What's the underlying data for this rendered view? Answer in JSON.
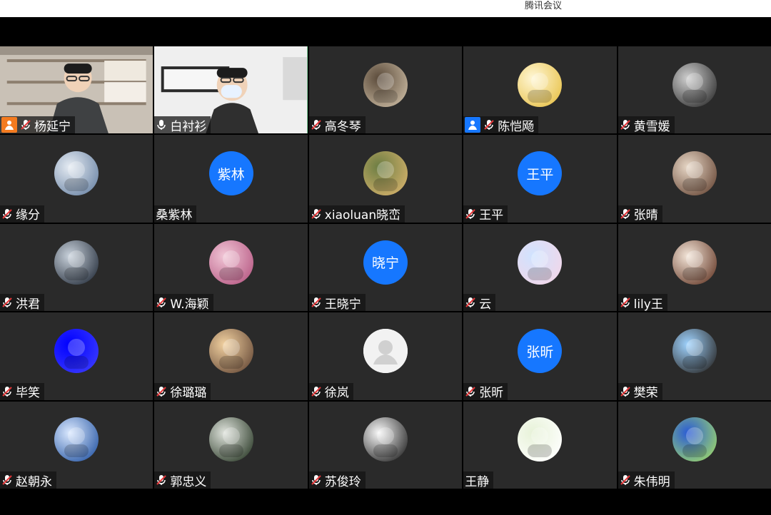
{
  "window": {
    "title": "腾讯会议"
  },
  "participants": [
    {
      "name": "杨延宁",
      "mic": "muted",
      "badge": "host",
      "avatar_type": "video",
      "avatar_desc": "man-with-glasses"
    },
    {
      "name": "白衬衫",
      "mic": "on",
      "badge": "",
      "avatar_type": "video",
      "avatar_desc": "woman-with-mask"
    },
    {
      "name": "高冬琴",
      "mic": "muted",
      "badge": "",
      "avatar_type": "image",
      "avatar_desc": "desk-coffee"
    },
    {
      "name": "陈恺飏",
      "mic": "muted",
      "badge": "cohost",
      "avatar_type": "image",
      "avatar_desc": "cartoon-duck"
    },
    {
      "name": "黄雪媛",
      "mic": "muted",
      "badge": "",
      "avatar_type": "image",
      "avatar_desc": "classical-portrait"
    },
    {
      "name": "缘分",
      "mic": "muted",
      "badge": "",
      "avatar_type": "image",
      "avatar_desc": "baby"
    },
    {
      "name": "桑紫林",
      "mic": "none",
      "badge": "",
      "avatar_type": "text",
      "avatar_text": "紫林"
    },
    {
      "name": "xiaoluan晓峦",
      "mic": "muted",
      "badge": "",
      "avatar_type": "image",
      "avatar_desc": "landscape"
    },
    {
      "name": "王平",
      "mic": "muted",
      "badge": "",
      "avatar_type": "text",
      "avatar_text": "王平"
    },
    {
      "name": "张晴",
      "mic": "muted",
      "badge": "",
      "avatar_type": "image",
      "avatar_desc": "anime-character"
    },
    {
      "name": "洪君",
      "mic": "muted",
      "badge": "",
      "avatar_type": "image",
      "avatar_desc": "anime-dark"
    },
    {
      "name": "W.海颖",
      "mic": "muted",
      "badge": "",
      "avatar_type": "image",
      "avatar_desc": "pink-room"
    },
    {
      "name": "王晓宁",
      "mic": "muted",
      "badge": "",
      "avatar_type": "text",
      "avatar_text": "晓宁"
    },
    {
      "name": "云",
      "mic": "muted",
      "badge": "",
      "avatar_type": "image",
      "avatar_desc": "blossoms"
    },
    {
      "name": "lily王",
      "mic": "muted",
      "badge": "",
      "avatar_type": "image",
      "avatar_desc": "girl-portrait"
    },
    {
      "name": "毕笑",
      "mic": "muted",
      "badge": "",
      "avatar_type": "image",
      "avatar_desc": "blue-screen"
    },
    {
      "name": "徐璐璐",
      "mic": "muted",
      "badge": "",
      "avatar_type": "image",
      "avatar_desc": "sunset-silhouette"
    },
    {
      "name": "徐岚",
      "mic": "muted",
      "badge": "",
      "avatar_type": "placeholder",
      "avatar_desc": "default-user"
    },
    {
      "name": "张昕",
      "mic": "muted",
      "badge": "",
      "avatar_type": "text",
      "avatar_text": "张昕"
    },
    {
      "name": "樊荣",
      "mic": "muted",
      "badge": "",
      "avatar_type": "image",
      "avatar_desc": "cartoon-man"
    },
    {
      "name": "赵朝永",
      "mic": "muted",
      "badge": "",
      "avatar_type": "image",
      "avatar_desc": "man-stage"
    },
    {
      "name": "郭忠义",
      "mic": "muted",
      "badge": "",
      "avatar_type": "image",
      "avatar_desc": "leaf-pattern"
    },
    {
      "name": "苏俊玲",
      "mic": "muted",
      "badge": "",
      "avatar_type": "image",
      "avatar_desc": "panda-mascot"
    },
    {
      "name": "王静",
      "mic": "none",
      "badge": "",
      "avatar_type": "image",
      "avatar_desc": "white-flower"
    },
    {
      "name": "朱伟明",
      "mic": "muted",
      "badge": "",
      "avatar_type": "image",
      "avatar_desc": "plant-blue"
    }
  ],
  "colors": {
    "tile_bg": "#2a2a2a",
    "speaking_border": "#2db55d",
    "text_avatar_bg": "#1677ff",
    "host_badge": "#f47b1f",
    "cohost_badge": "#1677ff",
    "muted_red": "#e5393b"
  }
}
